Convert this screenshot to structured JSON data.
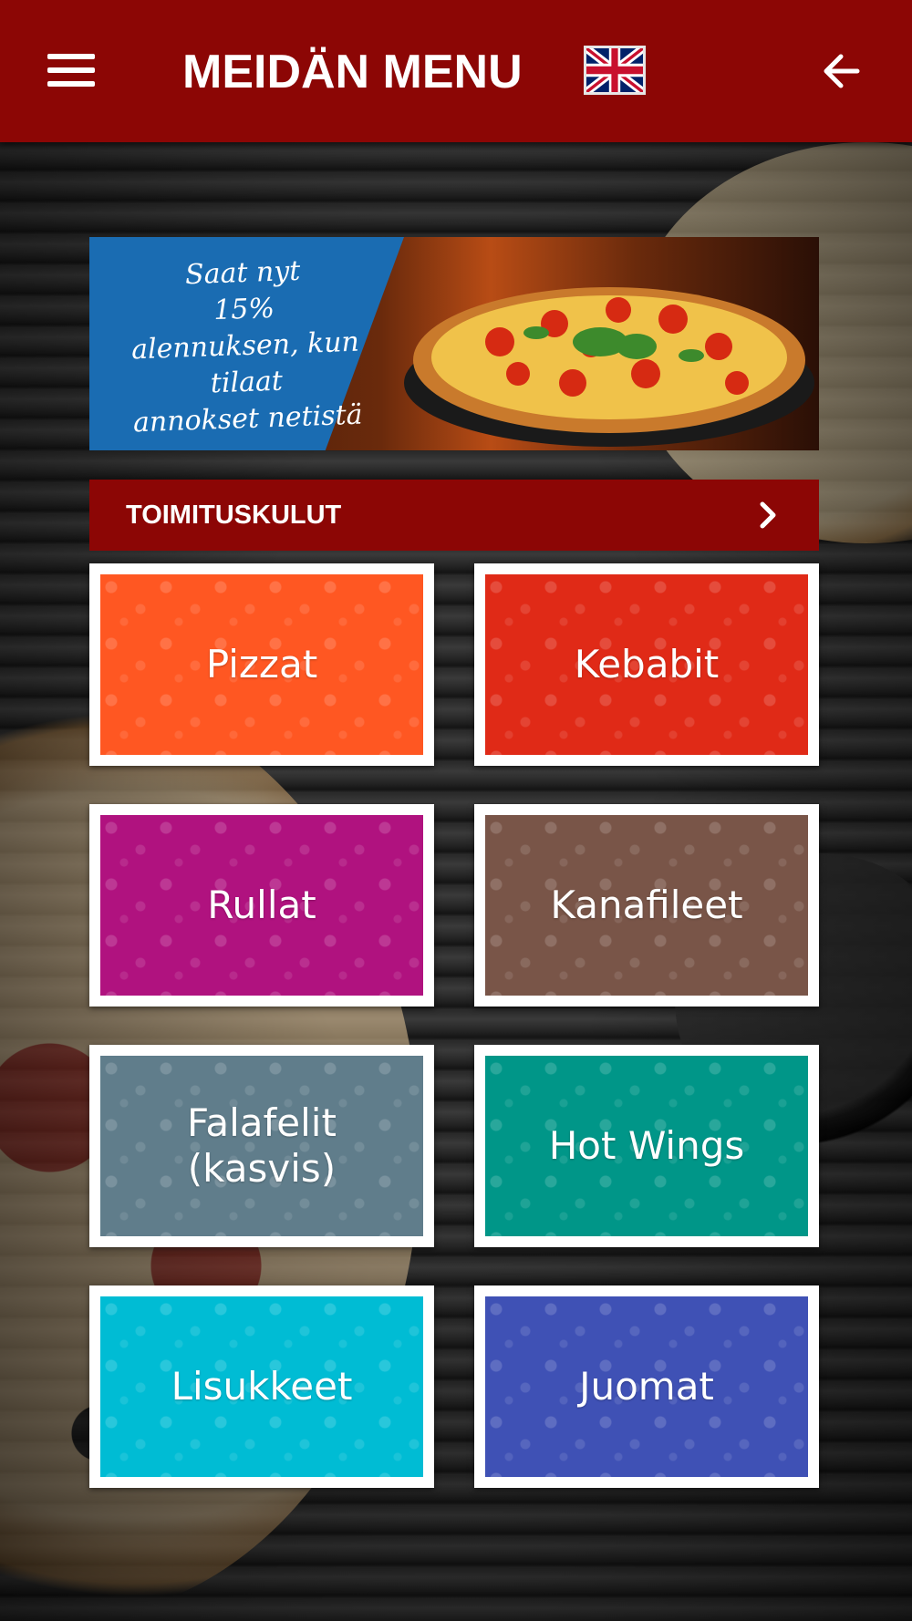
{
  "header": {
    "title": "MEIDÄN MENU",
    "menu_icon": "hamburger-menu-icon",
    "language_flag": "uk-flag-icon",
    "back_icon": "arrow-left-icon",
    "bg_color": "#8c0605"
  },
  "banner": {
    "lines": [
      "Saat nyt",
      "15%",
      "alennuksen, kun tilaat",
      "annokset netistä"
    ]
  },
  "delivery": {
    "label": "TOIMITUSKULUT",
    "icon": "chevron-right-icon"
  },
  "categories": [
    {
      "label": "Pizzat",
      "color": "#ff5722"
    },
    {
      "label": "Kebabit",
      "color": "#e02a17"
    },
    {
      "label": "Rullat",
      "color": "#b0127f"
    },
    {
      "label": "Kanafileet",
      "color": "#795548"
    },
    {
      "label": "Falafelit\n(kasvis)",
      "color": "#607d8b"
    },
    {
      "label": "Hot Wings",
      "color": "#009688"
    },
    {
      "label": "Lisukkeet",
      "color": "#00bcd4"
    },
    {
      "label": "Juomat",
      "color": "#3f51b5"
    }
  ]
}
